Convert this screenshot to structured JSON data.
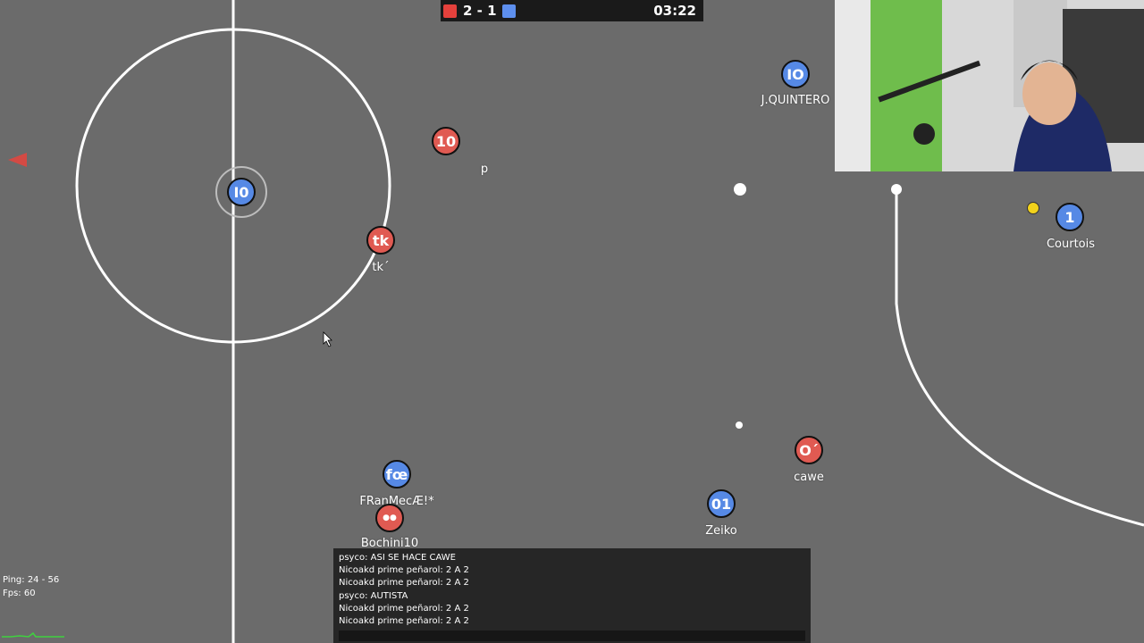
{
  "scoreboard": {
    "red_color": "#e5413c",
    "blue_color": "#5d8fee",
    "score": "2 - 1",
    "timer": "03:22"
  },
  "players": [
    {
      "label": "I0",
      "name": "",
      "team": "blue"
    },
    {
      "label": "10",
      "name": "p",
      "team": "red"
    },
    {
      "label": "tk",
      "name": "tk´",
      "team": "red"
    },
    {
      "label": "IO",
      "name": "J.QUINTERO",
      "team": "blue"
    },
    {
      "label": "1",
      "name": "Courtois",
      "team": "blue"
    },
    {
      "label": "O´",
      "name": "cawe",
      "team": "red"
    },
    {
      "label": "01",
      "name": "Zeiko",
      "team": "blue"
    },
    {
      "label": "fœ",
      "name": "FRanMecÆ!*",
      "team": "blue"
    },
    {
      "label": "●●",
      "name": "Bochini10",
      "team": "red"
    }
  ],
  "chat": {
    "messages": [
      "psyco: ASI SE HACE CAWE",
      "Nicoakd prime peñarol: 2 A 2",
      "Nicoakd prime peñarol: 2 A 2",
      "psyco: AUTISTA",
      "Nicoakd prime peñarol: 2 A 2",
      "Nicoakd prime peñarol: 2 A 2"
    ]
  },
  "stats": {
    "ping": "Ping: 24 - 56",
    "fps": "Fps: 60"
  },
  "colors": {
    "field": "#6b6b6b",
    "red_team": "#e05a52",
    "blue_team": "#5689e5",
    "lines": "#ffffff"
  }
}
